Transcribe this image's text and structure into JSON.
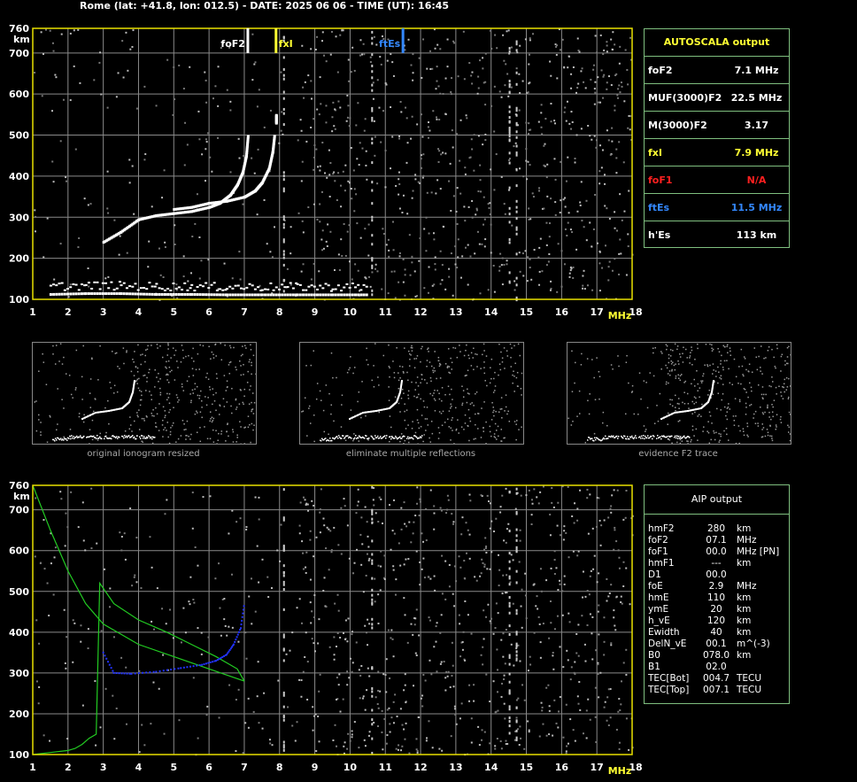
{
  "header": {
    "title": "Rome (lat: +41.8, lon: 012.5) - DATE: 2025 06 06 - TIME (UT): 16:45"
  },
  "colors": {
    "axis": "#e8e000",
    "grid": "#8a8a8a",
    "foF2": "#ffffff",
    "fxI": "#ffff33",
    "foF1": "#ff2020",
    "ftEs": "#3388ff",
    "profile": "#22cc22",
    "aipTrace": "#2233ff"
  },
  "ionogram_top": {
    "markers": {
      "foF2": "foF2",
      "fxI": "fxI",
      "ftEs": "ftEs"
    }
  },
  "autoscala": {
    "title": "AUTOSCALA output",
    "rows": [
      {
        "label": "foF2",
        "value": "7.1 MHz",
        "color": "#ffffff"
      },
      {
        "label": "MUF(3000)F2",
        "value": "22.5 MHz",
        "color": "#ffffff"
      },
      {
        "label": "M(3000)F2",
        "value": "3.17",
        "color": "#ffffff"
      },
      {
        "label": "fxI",
        "value": "7.9 MHz",
        "color": "#ffff33"
      },
      {
        "label": "foF1",
        "value": "N/A",
        "color": "#ff2020"
      },
      {
        "label": "ftEs",
        "value": "11.5 MHz",
        "color": "#3388ff"
      },
      {
        "label": "h'Es",
        "value": "113    km",
        "color": "#ffffff"
      }
    ]
  },
  "thumbnails": [
    {
      "caption": "original ionogram resized"
    },
    {
      "caption": "eliminate multiple reflections"
    },
    {
      "caption": "evidence F2 trace"
    }
  ],
  "aip": {
    "title": "AIP output",
    "rows": [
      [
        "hmF2",
        "280",
        "km"
      ],
      [
        "foF2",
        "07.1",
        "MHz"
      ],
      [
        "foF1",
        "00.0",
        "MHz   [PN]"
      ],
      [
        "hmF1",
        "---",
        "km"
      ],
      [
        "D1",
        "00.0",
        ""
      ],
      [
        "foE",
        "2.9",
        "MHz"
      ],
      [
        "hmE",
        "110",
        "km"
      ],
      [
        "ymE",
        "20",
        "km"
      ],
      [
        "h_vE",
        "120",
        "km"
      ],
      [
        "Ewidth",
        "40",
        "km"
      ],
      [
        "DelN_vE",
        "00.1",
        "m^(-3)"
      ],
      [
        "B0",
        "078.0",
        "km"
      ],
      [
        "B1",
        "02.0",
        ""
      ],
      [
        "TEC[Bot]",
        "004.7",
        "TECU"
      ],
      [
        "TEC[Top]",
        "007.1",
        "TECU"
      ]
    ]
  },
  "chart_data": [
    {
      "type": "scatter",
      "title": "",
      "xlabel": "MHz",
      "ylabel": "km",
      "xlim": [
        1,
        18
      ],
      "ylim": [
        100,
        760
      ],
      "xticks": [
        "1",
        "2",
        "3",
        "4",
        "5",
        "6",
        "7",
        "8",
        "9",
        "10",
        "11",
        "12",
        "13",
        "14",
        "15",
        "16",
        "17",
        "18"
      ],
      "yticks": [
        "100",
        "200",
        "300",
        "400",
        "500",
        "600",
        "700",
        "760"
      ],
      "grid": true,
      "series": [
        {
          "name": "foF2",
          "x": [
            3.0,
            3.5,
            4.0,
            4.5,
            5.0,
            5.5,
            6.0,
            6.3,
            6.6,
            6.8,
            6.95,
            7.05,
            7.1
          ],
          "y": [
            240,
            265,
            295,
            305,
            310,
            315,
            325,
            335,
            355,
            380,
            410,
            450,
            500
          ]
        },
        {
          "name": "foF2",
          "x": [
            5.0,
            5.5,
            6.0,
            6.5,
            7.0,
            7.3,
            7.5,
            7.7,
            7.8,
            7.85
          ],
          "y": [
            320,
            325,
            335,
            340,
            350,
            365,
            385,
            420,
            460,
            500
          ]
        },
        {
          "name": "fxI",
          "x": [
            7.9,
            7.9
          ],
          "y": [
            530,
            550
          ]
        },
        {
          "name": "h'Es",
          "x": [
            1.5,
            2.5,
            3.5,
            4.5,
            5.5,
            6.5,
            7.5,
            8.5,
            9.5,
            10.5
          ],
          "y": [
            113,
            115,
            115,
            113,
            113,
            112,
            112,
            112,
            112,
            112
          ]
        }
      ],
      "markers": [
        {
          "name": "foF2",
          "x": 7.1
        },
        {
          "name": "fxI",
          "x": 7.9
        },
        {
          "name": "ftEs",
          "x": 11.5
        }
      ]
    },
    {
      "type": "line",
      "title": "",
      "xlabel": "MHz",
      "ylabel": "km",
      "xlim": [
        1,
        18
      ],
      "ylim": [
        100,
        760
      ],
      "xticks": [
        "1",
        "2",
        "3",
        "4",
        "5",
        "6",
        "7",
        "8",
        "9",
        "10",
        "11",
        "12",
        "13",
        "14",
        "15",
        "16",
        "17",
        "18"
      ],
      "yticks": [
        "100",
        "200",
        "300",
        "400",
        "500",
        "600",
        "700",
        "760"
      ],
      "grid": true,
      "series": [
        {
          "name": "profile",
          "x": [
            7.0,
            6.8,
            6.2,
            5.5,
            4.8,
            4.0,
            3.3,
            2.9,
            2.8,
            2.6,
            2.4,
            2.2,
            2.0,
            1.5,
            1.0
          ],
          "y": [
            280,
            310,
            340,
            370,
            400,
            430,
            470,
            520,
            150,
            140,
            125,
            115,
            110,
            105,
            100
          ]
        },
        {
          "name": "profile",
          "x": [
            1.0,
            1.5,
            2.0,
            2.5,
            3.0,
            4.0,
            5.0,
            6.0,
            6.5,
            7.0
          ],
          "y": [
            760,
            650,
            550,
            470,
            420,
            370,
            340,
            310,
            295,
            280
          ]
        },
        {
          "name": "aip",
          "x": [
            3.0,
            3.3,
            3.8,
            4.5,
            5.2,
            5.8,
            6.2,
            6.5,
            6.7,
            6.9,
            7.0
          ],
          "y": [
            350,
            300,
            298,
            303,
            312,
            320,
            330,
            345,
            370,
            410,
            470
          ]
        }
      ]
    }
  ]
}
